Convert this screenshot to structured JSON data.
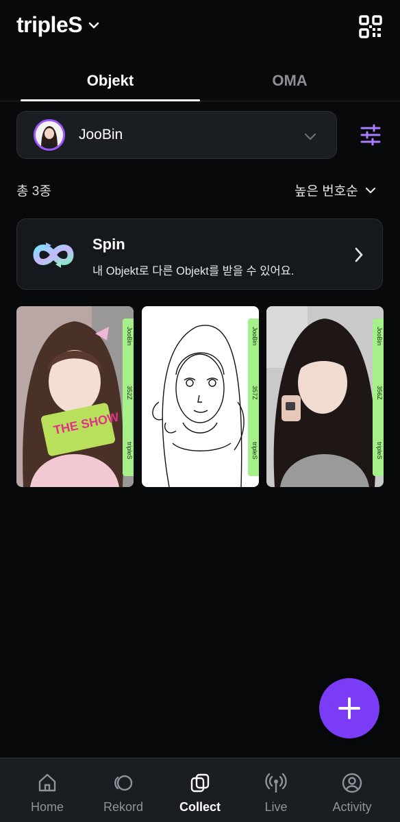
{
  "header": {
    "title": "tripleS",
    "qr_icon": "qr-code-icon"
  },
  "tabs": [
    {
      "label": "Objekt"
    },
    {
      "label": "OMA"
    }
  ],
  "member_select": {
    "name": "JooBin"
  },
  "list": {
    "count_label": "총 3종",
    "sort_label": "높은 번호순"
  },
  "spin": {
    "title": "Spin",
    "description": "내 Objekt로 다른 Objekt를 받을 수 있어요."
  },
  "objekts": [
    {
      "member": "JooBin",
      "serial": "352Z",
      "brand": "tripleS",
      "accent": "#a6f08a"
    },
    {
      "member": "JooBin",
      "serial": "357Z",
      "brand": "tripleS",
      "accent": "#a6f08a"
    },
    {
      "member": "JooBin",
      "serial": "356Z",
      "brand": "tripleS",
      "accent": "#a6f08a"
    }
  ],
  "fab": {
    "icon": "plus-icon"
  },
  "nav": [
    {
      "label": "Home",
      "icon": "home-icon"
    },
    {
      "label": "Rekord",
      "icon": "rekord-icon"
    },
    {
      "label": "Collect",
      "icon": "collect-icon",
      "active": true
    },
    {
      "label": "Live",
      "icon": "live-icon"
    },
    {
      "label": "Activity",
      "icon": "profile-icon"
    }
  ],
  "colors": {
    "background": "#08090b",
    "accent": "#7b3cf5",
    "card_strip": "#a6f08a",
    "avatar_ring": "#9d55ff"
  }
}
